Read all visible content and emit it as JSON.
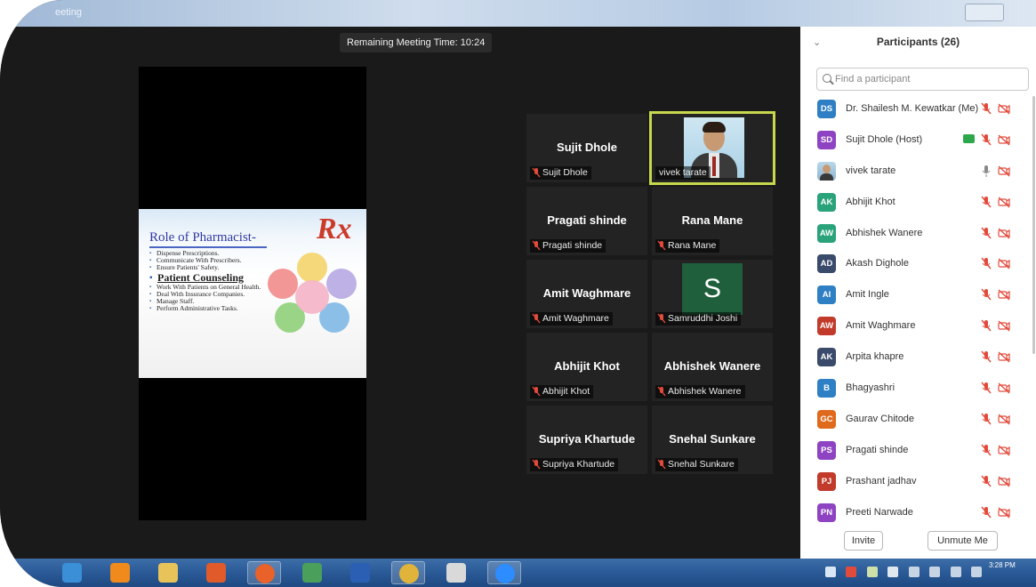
{
  "window": {
    "title": "eeting"
  },
  "meeting": {
    "timer_text": "Remaining Meeting Time: 10:24",
    "slide": {
      "title": "Role of Pharmacist-",
      "logo_text": "Rx",
      "bullets": [
        "Dispense Prescriptions.",
        "Communicate With Prescribers.",
        "Ensure Patients' Safety."
      ],
      "highlight": "Patient Counseling",
      "bullets2": [
        "Work With Patients on General Health.",
        "Deal With Insurance Companies.",
        "Manage Staff.",
        "Perform Administrative Tasks."
      ]
    },
    "tiles": [
      {
        "name": "Sujit Dhole",
        "label": "Sujit Dhole",
        "type": "name"
      },
      {
        "name": "",
        "label": "vivek tarate",
        "type": "photo"
      },
      {
        "name": "Pragati shinde",
        "label": "Pragati shinde",
        "type": "name"
      },
      {
        "name": "Rana Mane",
        "label": "Rana Mane",
        "type": "name"
      },
      {
        "name": "Amit Waghmare",
        "label": "Amit Waghmare",
        "type": "name"
      },
      {
        "name": "S",
        "label": "Samruddhi Joshi",
        "type": "avatar"
      },
      {
        "name": "Abhijit Khot",
        "label": "Abhijit Khot",
        "type": "name"
      },
      {
        "name": "Abhishek Wanere",
        "label": "Abhishek Wanere",
        "type": "name"
      },
      {
        "name": "Supriya Khartude",
        "label": "Supriya Khartude",
        "type": "name"
      },
      {
        "name": "Snehal Sunkare",
        "label": "Snehal Sunkare",
        "type": "name"
      }
    ]
  },
  "participants": {
    "title": "Participants (26)",
    "search_placeholder": "Find a participant",
    "list": [
      {
        "initials": "DS",
        "name": "Dr. Shailesh M. Kewatkar (Me)",
        "color": "#2e7fc4"
      },
      {
        "initials": "SD",
        "name": "Sujit Dhole (Host)",
        "color": "#8e44c2"
      },
      {
        "initials": "",
        "name": "vivek tarate",
        "color": ""
      },
      {
        "initials": "AK",
        "name": "Abhijit Khot",
        "color": "#2aa37a"
      },
      {
        "initials": "AW",
        "name": "Abhishek Wanere",
        "color": "#2aa37a"
      },
      {
        "initials": "AD",
        "name": "Akash Dighole",
        "color": "#3a4a6b"
      },
      {
        "initials": "AI",
        "name": "Amit Ingle",
        "color": "#2e7fc4"
      },
      {
        "initials": "AW",
        "name": "Amit Waghmare",
        "color": "#c23a2a"
      },
      {
        "initials": "AK",
        "name": "Arpita khapre",
        "color": "#3a4a6b"
      },
      {
        "initials": "B",
        "name": "Bhagyashri",
        "color": "#2e7fc4"
      },
      {
        "initials": "GC",
        "name": "Gaurav Chitode",
        "color": "#e06a1c"
      },
      {
        "initials": "PS",
        "name": "Pragati shinde",
        "color": "#8e44c2"
      },
      {
        "initials": "PJ",
        "name": "Prashant jadhav",
        "color": "#c23a2a"
      },
      {
        "initials": "PN",
        "name": "Preeti Narwade",
        "color": "#8e44c2"
      }
    ],
    "invite_label": "Invite",
    "unmute_label": "Unmute Me"
  },
  "taskbar": {
    "apps": [
      {
        "name": "internet-explorer-icon",
        "color": "#3a8fd6"
      },
      {
        "name": "vlc-icon",
        "color": "#f08a1c"
      },
      {
        "name": "file-explorer-icon",
        "color": "#e8c35a"
      },
      {
        "name": "media-player-icon",
        "color": "#e05a2a"
      },
      {
        "name": "firefox-icon",
        "color": "#e8622a"
      },
      {
        "name": "photo-viewer-icon",
        "color": "#4aa05a"
      },
      {
        "name": "word-icon",
        "color": "#2b5fb3"
      },
      {
        "name": "chrome-icon",
        "color": "#e0b43a"
      },
      {
        "name": "paint-icon",
        "color": "#d9d9d9"
      },
      {
        "name": "zoom-icon",
        "color": "#2d8cff"
      }
    ],
    "clock": "3:28 PM"
  }
}
